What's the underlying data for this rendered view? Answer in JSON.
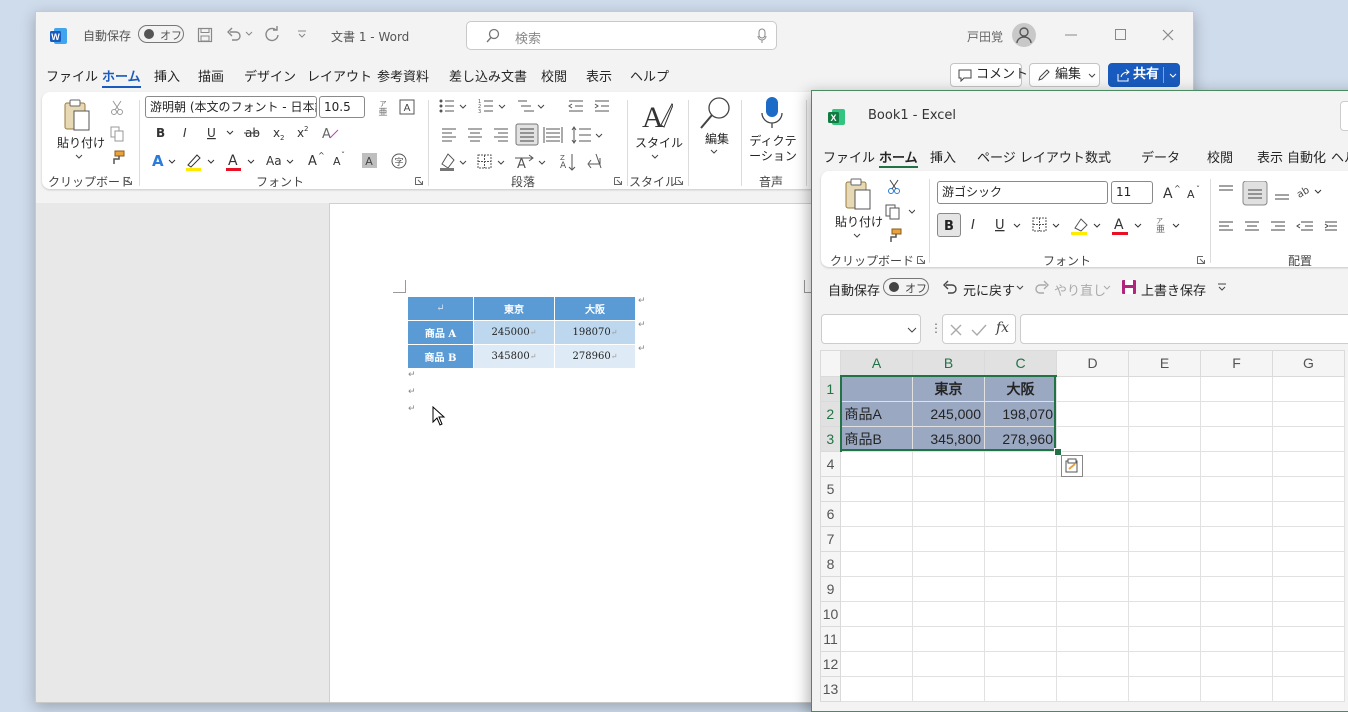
{
  "word": {
    "autosave_label": "自動保存",
    "autosave_state": "オフ",
    "doc_title": "文書 1",
    "app_name": "Word",
    "title_sep": "-",
    "search_placeholder": "検索",
    "user_name": "戸田覚",
    "tabs": [
      "ファイル",
      "ホーム",
      "挿入",
      "描画",
      "デザイン",
      "レイアウト",
      "参考資料",
      "差し込み文書",
      "校閲",
      "表示",
      "ヘルプ"
    ],
    "comment_btn": "コメント",
    "edit_btn": "編集",
    "share_btn": "共有",
    "ribbon": {
      "paste": "貼り付け",
      "clipboard": "クリップボード",
      "font_name": "游明朝 (本文のフォント - 日本語)",
      "font_size": "10.5",
      "font_group": "フォント",
      "para_group": "段落",
      "style_btn": "スタイル",
      "style_group": "スタイル",
      "edit_btn": "編集",
      "dictate_btn": "ディクテーション",
      "voice_group": "音声"
    },
    "table": {
      "header": [
        "東京",
        "大阪"
      ],
      "rows": [
        {
          "label": "商品 A",
          "v1": "245000",
          "v2": "198070"
        },
        {
          "label": "商品 B",
          "v1": "345800",
          "v2": "278960"
        }
      ]
    },
    "para_mark": "↵"
  },
  "excel": {
    "title": "Book1",
    "app_name": "Excel",
    "title_sep": "-",
    "tabs": [
      "ファイル",
      "ホーム",
      "挿入",
      "ページ レイアウト",
      "数式",
      "データ",
      "校閲",
      "表示",
      "自動化",
      "ヘル"
    ],
    "ribbon": {
      "paste": "貼り付け",
      "clipboard": "クリップボード",
      "font_name": "游ゴシック",
      "font_size": "11",
      "font_group": "フォント",
      "align_group": "配置"
    },
    "qat": {
      "autosave_label": "自動保存",
      "autosave_state": "オフ",
      "undo": "元に戻す",
      "redo": "やり直し",
      "save": "上書き保存"
    },
    "fx_label": "fx",
    "columns": [
      "A",
      "B",
      "C",
      "D",
      "E",
      "F",
      "G"
    ],
    "rows": [
      "1",
      "2",
      "3",
      "4",
      "5",
      "6",
      "7",
      "8",
      "9",
      "10",
      "11",
      "12",
      "13"
    ],
    "cells": {
      "B1": "東京",
      "C1": "大阪",
      "A2": "商品A",
      "B2": "245,000",
      "C2": "198,070",
      "A3": "商品B",
      "B3": "345,800",
      "C3": "278,960"
    },
    "colors": {
      "accent": "#217346",
      "selection": "#9aa8c2"
    }
  },
  "colors": {
    "word_blue": "#185abd",
    "table_header": "#5b9bd5",
    "table_cell": "#bdd7ee",
    "table_cell_alt": "#deebf7"
  }
}
